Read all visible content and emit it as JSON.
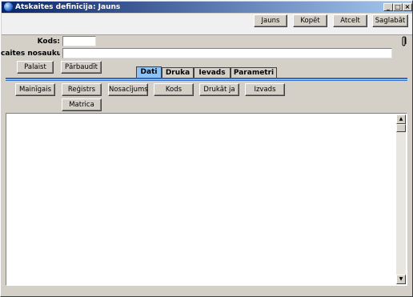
{
  "window": {
    "title": "Atskaites definīcija: Jauns",
    "controls": {
      "minimize": "_",
      "maximize": "□",
      "close": "×"
    }
  },
  "toolbar": {
    "jauns": "Jauns",
    "kopet": "Kopēt",
    "atcelt": "Atcelt",
    "saglabat": "Saglabāt"
  },
  "form": {
    "kods_label": "Kods:",
    "kods_value": "",
    "nosaukums_label": "caites nosaukums:",
    "nosaukums_value": ""
  },
  "actions": {
    "palaist": "Palaist",
    "parbaudit": "Pārbaudīt"
  },
  "tabs": [
    {
      "label": "Dati",
      "active": true
    },
    {
      "label": "Druka",
      "active": false
    },
    {
      "label": "Ievads",
      "active": false
    },
    {
      "label": "Parametri",
      "active": false
    }
  ],
  "inner_buttons": {
    "mainigais": "Mainīgais",
    "registrs": "Reģistrs",
    "nosacijums": "Nosacījums",
    "kods": "Kods",
    "drukat_ja": "Drukāt ja",
    "izvads": "Izvads",
    "matrica": "Matrica"
  },
  "icons": {
    "title": "app-globe-icon",
    "attachment": "paperclip-icon",
    "scroll_up": "arrow-up-icon",
    "scroll_down": "arrow-down-icon"
  },
  "colors": {
    "titlebar_start": "#0a246a",
    "titlebar_end": "#a6caf0",
    "active_tab": "#8ec2f5",
    "separator": "#316ac5"
  }
}
